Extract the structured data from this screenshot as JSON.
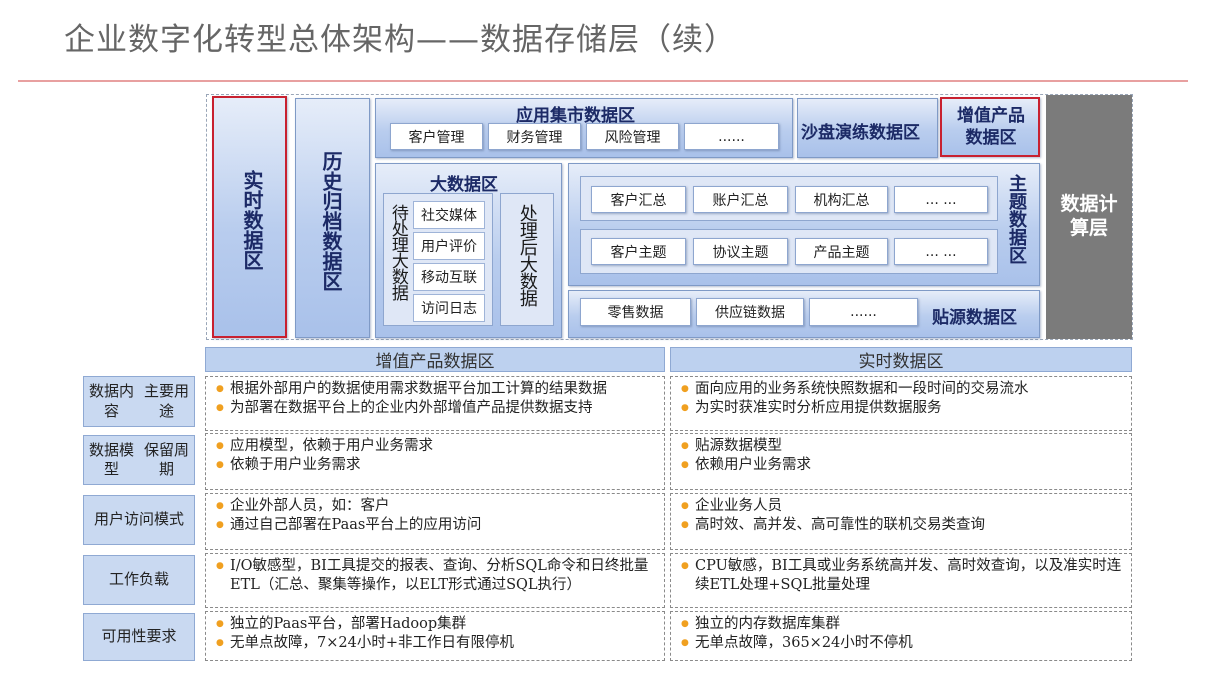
{
  "title": "企业数字化转型总体架构——数据存储层（续）",
  "diagram": {
    "realtime_zone": "实时数据区",
    "history_zone": "历史归档数据区",
    "app_mart_zone": {
      "title": "应用集市数据区",
      "items": [
        "客户管理",
        "财务管理",
        "风险管理",
        "......"
      ]
    },
    "sandbox_zone": "沙盘演练数据区",
    "value_product_zone": "增值产品数据区",
    "big_data_zone": {
      "title": "大数据区",
      "pending_label": "待处理大数据",
      "pending_items": [
        "社交媒体",
        "用户评价",
        "移动互联",
        "访问日志"
      ],
      "processed_label": "处理后大数据"
    },
    "subject_zone": {
      "label": "主题数据区",
      "summary_items": [
        "客户汇总",
        "账户汇总",
        "机构汇总",
        "... ..."
      ],
      "subject_items": [
        "客户主题",
        "协议主题",
        "产品主题",
        "... ..."
      ]
    },
    "source_zone": {
      "label": "贴源数据区",
      "items": [
        "零售数据",
        "供应链数据",
        "......"
      ]
    },
    "compute_layer": "数据计算层"
  },
  "table": {
    "columns": [
      "增值产品数据区",
      "实时数据区"
    ],
    "rows": [
      {
        "label": "数据内容主要用途",
        "left": [
          "根据外部用户的数据使用需求数据平台加工计算的结果数据",
          "为部署在数据平台上的企业内外部增值产品提供数据支持"
        ],
        "right": [
          "面向应用的业务系统快照数据和一段时间的交易流水",
          "为实时获准实时分析应用提供数据服务"
        ]
      },
      {
        "label": "数据模型保留周期",
        "left": [
          "应用模型，依赖于用户业务需求",
          "依赖于用户业务需求"
        ],
        "right": [
          "贴源数据模型",
          "依赖用户业务需求"
        ]
      },
      {
        "label": "用户访问模式",
        "left": [
          "企业外部人员，如：客户",
          "通过自己部署在Paas平台上的应用访问"
        ],
        "right": [
          "企业业务人员",
          "高时效、高并发、高可靠性的联机交易类查询"
        ]
      },
      {
        "label": "工作负载",
        "left": [
          "I/O敏感型，BI工具提交的报表、查询、分析SQL命令和日终批量ETL（汇总、聚集等操作，以ELT形式通过SQL执行）"
        ],
        "right": [
          "CPU敏感，BI工具或业务系统高并发、高时效查询，以及准实时连续ETL处理+SQL批量处理"
        ]
      },
      {
        "label": "可用性要求",
        "left": [
          "独立的Paas平台，部署Hadoop集群",
          "无单点故障，7×24小时+非工作日有限停机"
        ],
        "right": [
          "独立的内存数据库集群",
          "无单点故障，365×24小时不停机"
        ]
      }
    ]
  },
  "colors": {
    "accent_red": "#c8202f",
    "bullet": "#f0a020",
    "box_blue": "#b9cdee",
    "compute_grey": "#7b7b7b"
  }
}
